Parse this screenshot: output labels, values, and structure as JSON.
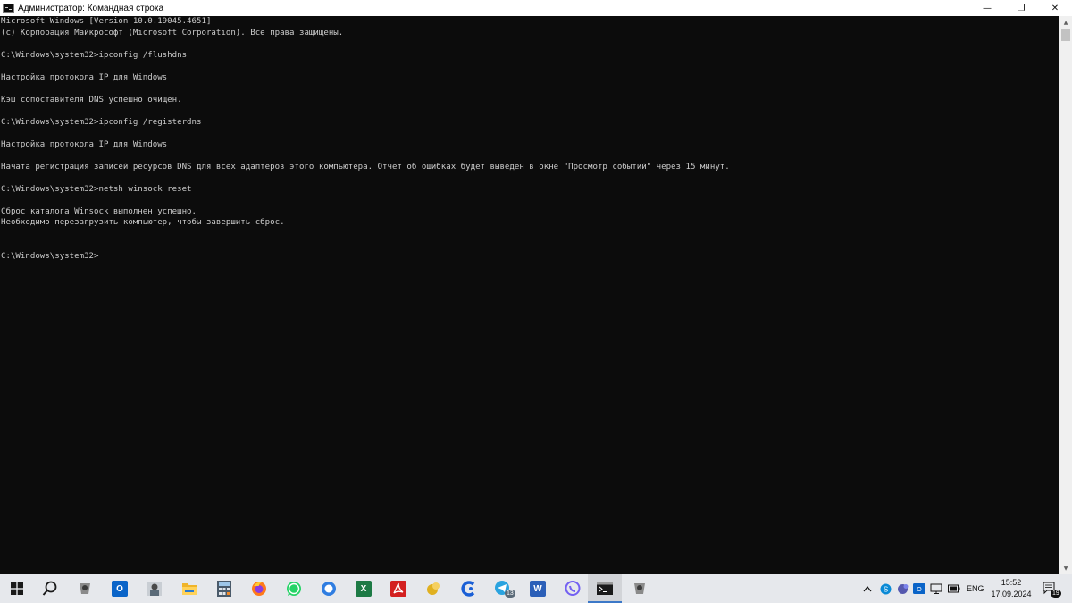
{
  "window": {
    "title": "Администратор: Командная строка",
    "minimize_glyph": "—",
    "maximize_glyph": "❐",
    "close_glyph": "✕"
  },
  "console": {
    "lines": [
      "Microsoft Windows [Version 10.0.19045.4651]",
      "(c) Корпорация Майкрософт (Microsoft Corporation). Все права защищены.",
      "",
      "C:\\Windows\\system32>ipconfig /flushdns",
      "",
      "Настройка протокола IP для Windows",
      "",
      "Кэш сопоставителя DNS успешно очищен.",
      "",
      "C:\\Windows\\system32>ipconfig /registerdns",
      "",
      "Настройка протокола IP для Windows",
      "",
      "Начата регистрация записей ресурсов DNS для всех адаптеров этого компьютера. Отчет об ошибках будет выведен в окне \"Просмотр событий\" через 15 минут.",
      "",
      "C:\\Windows\\system32>netsh winsock reset",
      "",
      "Сброс каталога Winsock выполнен успешно.",
      "Необходимо перезагрузить компьютер, чтобы завершить сброс.",
      "",
      "",
      "C:\\Windows\\system32>"
    ]
  },
  "taskbar": {
    "pinned": [
      {
        "name": "start-icon",
        "color": "#1a1a1a"
      },
      {
        "name": "search-icon",
        "color": "#1a1a1a"
      },
      {
        "name": "app-icon-1",
        "color": "#6b6b6b"
      },
      {
        "name": "outlook-icon",
        "color": "#0a64c8"
      },
      {
        "name": "photo-app-icon",
        "color": "#5a6a78"
      },
      {
        "name": "file-explorer-icon",
        "color": "#f0b429"
      },
      {
        "name": "calculator-icon",
        "color": "#4a5a6a"
      },
      {
        "name": "firefox-icon",
        "color": "#ff7a1a"
      },
      {
        "name": "whatsapp-icon",
        "color": "#25d366"
      },
      {
        "name": "messenger-icon",
        "color": "#2f7de1"
      },
      {
        "name": "excel-icon",
        "color": "#1d7a45"
      },
      {
        "name": "pdf-reader-icon",
        "color": "#d32020"
      },
      {
        "name": "app-icon-2",
        "color": "#e0b020"
      },
      {
        "name": "browser-c-icon",
        "color": "#1a5fd6"
      },
      {
        "name": "telegram-icon",
        "color": "#2aa3df"
      },
      {
        "name": "word-icon",
        "color": "#2b5fb8"
      },
      {
        "name": "viber-icon",
        "color": "#7360f2"
      },
      {
        "name": "command-prompt-icon",
        "color": "#1a1a1a"
      },
      {
        "name": "app-icon-3",
        "color": "#6b6b6b"
      }
    ],
    "excel_letter": "X",
    "word_letter": "W",
    "outlook_letter": "O",
    "telegram_badge": "13",
    "tray": {
      "chevron": "^",
      "language": "ENG",
      "time": "15:52",
      "date": "17.09.2024",
      "notifications": "19"
    }
  }
}
